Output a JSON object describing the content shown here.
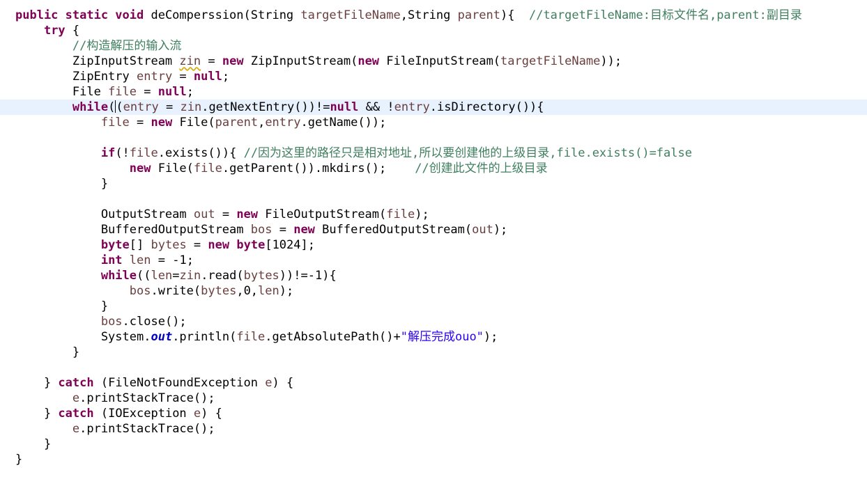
{
  "code": {
    "current_line": 7,
    "lines": [
      {
        "tokens": [
          {
            "t": "public static void",
            "c": "kw"
          },
          {
            "t": " deComperssion(String ",
            "c": "pl"
          },
          {
            "t": "targetFileName",
            "c": "var"
          },
          {
            "t": ",String ",
            "c": "pl"
          },
          {
            "t": "parent",
            "c": "var"
          },
          {
            "t": "){  ",
            "c": "pl"
          },
          {
            "t": "//targetFileName:目标文件名,parent:副目录",
            "c": "cm"
          }
        ]
      },
      {
        "tokens": [
          {
            "t": "    ",
            "c": "pl"
          },
          {
            "t": "try",
            "c": "kw"
          },
          {
            "t": " {",
            "c": "pl"
          }
        ]
      },
      {
        "tokens": [
          {
            "t": "        ",
            "c": "pl"
          },
          {
            "t": "//构造解压的输入流",
            "c": "cm"
          }
        ]
      },
      {
        "tokens": [
          {
            "t": "        ZipInputStream ",
            "c": "pl"
          },
          {
            "t": "zin",
            "c": "var",
            "warn": true
          },
          {
            "t": " = ",
            "c": "pl"
          },
          {
            "t": "new",
            "c": "kw"
          },
          {
            "t": " ZipInputStream(",
            "c": "pl"
          },
          {
            "t": "new",
            "c": "kw"
          },
          {
            "t": " FileInputStream(",
            "c": "pl"
          },
          {
            "t": "targetFileName",
            "c": "var"
          },
          {
            "t": "));",
            "c": "pl"
          }
        ]
      },
      {
        "tokens": [
          {
            "t": "        ZipEntry ",
            "c": "pl"
          },
          {
            "t": "entry",
            "c": "var"
          },
          {
            "t": " = ",
            "c": "pl"
          },
          {
            "t": "null",
            "c": "kw"
          },
          {
            "t": ";",
            "c": "pl"
          }
        ]
      },
      {
        "tokens": [
          {
            "t": "        File ",
            "c": "pl"
          },
          {
            "t": "file",
            "c": "var"
          },
          {
            "t": " = ",
            "c": "pl"
          },
          {
            "t": "null",
            "c": "kw"
          },
          {
            "t": ";",
            "c": "pl"
          }
        ]
      },
      {
        "tokens": [
          {
            "t": "        ",
            "c": "pl"
          },
          {
            "t": "while",
            "c": "kw"
          },
          {
            "t": "((",
            "c": "pl",
            "caret": true
          },
          {
            "t": "entry",
            "c": "var"
          },
          {
            "t": " = ",
            "c": "pl"
          },
          {
            "t": "zin",
            "c": "var"
          },
          {
            "t": ".getNextEntry())!=",
            "c": "pl"
          },
          {
            "t": "null",
            "c": "kw"
          },
          {
            "t": " && !",
            "c": "pl"
          },
          {
            "t": "entry",
            "c": "var"
          },
          {
            "t": ".isDirectory()){",
            "c": "pl"
          }
        ]
      },
      {
        "tokens": [
          {
            "t": "            ",
            "c": "pl"
          },
          {
            "t": "file",
            "c": "var"
          },
          {
            "t": " = ",
            "c": "pl"
          },
          {
            "t": "new",
            "c": "kw"
          },
          {
            "t": " File(",
            "c": "pl"
          },
          {
            "t": "parent",
            "c": "var"
          },
          {
            "t": ",",
            "c": "pl"
          },
          {
            "t": "entry",
            "c": "var"
          },
          {
            "t": ".getName());",
            "c": "pl"
          }
        ]
      },
      {
        "tokens": []
      },
      {
        "tokens": [
          {
            "t": "            ",
            "c": "pl"
          },
          {
            "t": "if",
            "c": "kw"
          },
          {
            "t": "(!",
            "c": "pl"
          },
          {
            "t": "file",
            "c": "var"
          },
          {
            "t": ".exists()){ ",
            "c": "pl"
          },
          {
            "t": "//因为这里的路径只是相对地址,所以要创建他的上级目录,file.exists()=false",
            "c": "cm"
          }
        ]
      },
      {
        "tokens": [
          {
            "t": "                ",
            "c": "pl"
          },
          {
            "t": "new",
            "c": "kw"
          },
          {
            "t": " File(",
            "c": "pl"
          },
          {
            "t": "file",
            "c": "var"
          },
          {
            "t": ".getParent()).mkdirs();    ",
            "c": "pl"
          },
          {
            "t": "//创建此文件的上级目录",
            "c": "cm"
          }
        ]
      },
      {
        "tokens": [
          {
            "t": "            }",
            "c": "pl"
          }
        ]
      },
      {
        "tokens": []
      },
      {
        "tokens": [
          {
            "t": "            OutputStream ",
            "c": "pl"
          },
          {
            "t": "out",
            "c": "var"
          },
          {
            "t": " = ",
            "c": "pl"
          },
          {
            "t": "new",
            "c": "kw"
          },
          {
            "t": " FileOutputStream(",
            "c": "pl"
          },
          {
            "t": "file",
            "c": "var"
          },
          {
            "t": ");",
            "c": "pl"
          }
        ]
      },
      {
        "tokens": [
          {
            "t": "            BufferedOutputStream ",
            "c": "pl"
          },
          {
            "t": "bos",
            "c": "var"
          },
          {
            "t": " = ",
            "c": "pl"
          },
          {
            "t": "new",
            "c": "kw"
          },
          {
            "t": " BufferedOutputStream(",
            "c": "pl"
          },
          {
            "t": "out",
            "c": "var"
          },
          {
            "t": ");",
            "c": "pl"
          }
        ]
      },
      {
        "tokens": [
          {
            "t": "            ",
            "c": "pl"
          },
          {
            "t": "byte",
            "c": "kw"
          },
          {
            "t": "[] ",
            "c": "pl"
          },
          {
            "t": "bytes",
            "c": "var"
          },
          {
            "t": " = ",
            "c": "pl"
          },
          {
            "t": "new",
            "c": "kw"
          },
          {
            "t": " ",
            "c": "pl"
          },
          {
            "t": "byte",
            "c": "kw"
          },
          {
            "t": "[1024];",
            "c": "pl"
          }
        ]
      },
      {
        "tokens": [
          {
            "t": "            ",
            "c": "pl"
          },
          {
            "t": "int",
            "c": "kw"
          },
          {
            "t": " ",
            "c": "pl"
          },
          {
            "t": "len",
            "c": "var"
          },
          {
            "t": " = -1;",
            "c": "pl"
          }
        ]
      },
      {
        "tokens": [
          {
            "t": "            ",
            "c": "pl"
          },
          {
            "t": "while",
            "c": "kw"
          },
          {
            "t": "((",
            "c": "pl"
          },
          {
            "t": "len",
            "c": "var"
          },
          {
            "t": "=",
            "c": "pl"
          },
          {
            "t": "zin",
            "c": "var"
          },
          {
            "t": ".read(",
            "c": "pl"
          },
          {
            "t": "bytes",
            "c": "var"
          },
          {
            "t": "))!=-1){",
            "c": "pl"
          }
        ]
      },
      {
        "tokens": [
          {
            "t": "                ",
            "c": "pl"
          },
          {
            "t": "bos",
            "c": "var"
          },
          {
            "t": ".write(",
            "c": "pl"
          },
          {
            "t": "bytes",
            "c": "var"
          },
          {
            "t": ",0,",
            "c": "pl"
          },
          {
            "t": "len",
            "c": "var"
          },
          {
            "t": ");",
            "c": "pl"
          }
        ]
      },
      {
        "tokens": [
          {
            "t": "            }",
            "c": "pl"
          }
        ]
      },
      {
        "tokens": [
          {
            "t": "            ",
            "c": "pl"
          },
          {
            "t": "bos",
            "c": "var"
          },
          {
            "t": ".close();",
            "c": "pl"
          }
        ]
      },
      {
        "tokens": [
          {
            "t": "            System.",
            "c": "pl"
          },
          {
            "t": "out",
            "c": "fld"
          },
          {
            "t": ".println(",
            "c": "pl"
          },
          {
            "t": "file",
            "c": "var"
          },
          {
            "t": ".getAbsolutePath()+",
            "c": "pl"
          },
          {
            "t": "\"解压完成ouo\"",
            "c": "str"
          },
          {
            "t": ");",
            "c": "pl"
          }
        ]
      },
      {
        "tokens": [
          {
            "t": "        }",
            "c": "pl"
          }
        ]
      },
      {
        "tokens": []
      },
      {
        "tokens": [
          {
            "t": "    } ",
            "c": "pl"
          },
          {
            "t": "catch",
            "c": "kw"
          },
          {
            "t": " (FileNotFoundException ",
            "c": "pl"
          },
          {
            "t": "e",
            "c": "var"
          },
          {
            "t": ") {",
            "c": "pl"
          }
        ]
      },
      {
        "tokens": [
          {
            "t": "        ",
            "c": "pl"
          },
          {
            "t": "e",
            "c": "var"
          },
          {
            "t": ".printStackTrace();",
            "c": "pl"
          }
        ]
      },
      {
        "tokens": [
          {
            "t": "    } ",
            "c": "pl"
          },
          {
            "t": "catch",
            "c": "kw"
          },
          {
            "t": " (IOException ",
            "c": "pl"
          },
          {
            "t": "e",
            "c": "var"
          },
          {
            "t": ") {",
            "c": "pl"
          }
        ]
      },
      {
        "tokens": [
          {
            "t": "        ",
            "c": "pl"
          },
          {
            "t": "e",
            "c": "var"
          },
          {
            "t": ".printStackTrace();",
            "c": "pl"
          }
        ]
      },
      {
        "tokens": [
          {
            "t": "    }",
            "c": "pl"
          }
        ]
      },
      {
        "tokens": [
          {
            "t": "}",
            "c": "pl"
          }
        ]
      }
    ]
  }
}
